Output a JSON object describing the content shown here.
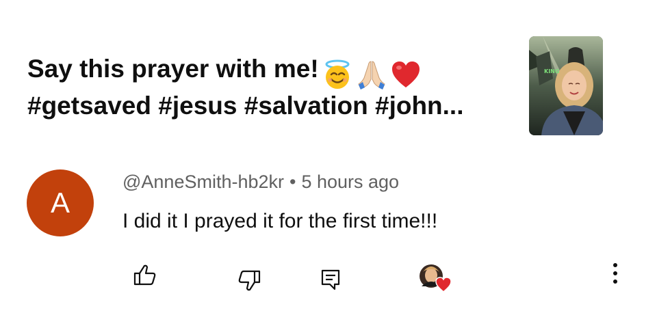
{
  "video": {
    "title_line1": "Say this prayer with me!",
    "title_line2": "#getsaved #jesus #salvation #john...",
    "emojis": [
      "halo-smile-emoji",
      "praying-hands-emoji",
      "red-heart-emoji"
    ],
    "thumbnail_text": "KING"
  },
  "comment": {
    "avatar_letter": "A",
    "author": "@AnneSmith-hb2kr",
    "separator": "•",
    "time": "5 hours ago",
    "text": "I did it I prayed it for the first time!!!"
  },
  "actions": {
    "icons": [
      "thumbs-up-icon",
      "thumbs-down-icon",
      "reply-icon",
      "creator-heart-icon",
      "more-vert-icon"
    ]
  },
  "colors": {
    "avatar_bg": "#c2410c",
    "meta_text": "#606060",
    "primary_text": "#0f0f0f",
    "heart": "#e0282e"
  }
}
